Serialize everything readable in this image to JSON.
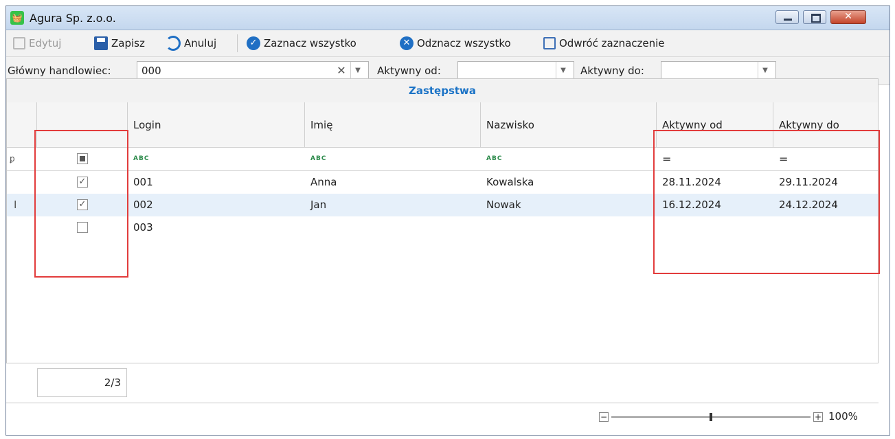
{
  "window": {
    "title": "Agura Sp. z.o.o.",
    "close_glyph": "✕"
  },
  "toolbar": {
    "edit_label": "Edytuj",
    "save_label": "Zapisz",
    "cancel_label": "Anuluj",
    "select_all_label": "Zaznacz wszystko",
    "deselect_all_label": "Odznacz wszystko",
    "invert_label": "Odwróć zaznaczenie",
    "check_glyph": "✓",
    "x_glyph": "✕"
  },
  "filters": {
    "main_dealer_label": "Główny handlowiec:",
    "main_dealer_value": "000",
    "active_from_label": "Aktywny od:",
    "active_from_value": "",
    "active_to_label": "Aktywny do:",
    "active_to_value": "",
    "clear_glyph": "✕",
    "dropdown_glyph": "▼"
  },
  "grid": {
    "group_title": "Zastępstwa",
    "columns": {
      "login": "Login",
      "imie": "Imię",
      "nazwisko": "Nazwisko",
      "aktywny_od": "Aktywny od",
      "aktywny_do": "Aktywny do"
    },
    "filter_row": {
      "pin_glyph": "ꝑ",
      "text_glyph": "ABC",
      "equals_glyph": "="
    },
    "rows": [
      {
        "checked": "✓",
        "login": "001",
        "imie": "Anna",
        "nazwisko": "Kowalska",
        "aktywny_od": "28.11.2024",
        "aktywny_do": "29.11.2024"
      },
      {
        "checked": "✓",
        "login": "002",
        "imie": "Jan",
        "nazwisko": "Nowak",
        "aktywny_od": "16.12.2024",
        "aktywny_do": "24.12.2024",
        "cursor": "I"
      },
      {
        "checked": "",
        "login": "003",
        "imie": "",
        "nazwisko": "",
        "aktywny_od": "",
        "aktywny_do": ""
      }
    ],
    "record_counter": "2/3"
  },
  "zoom": {
    "minus": "−",
    "plus": "+",
    "level": "100%",
    "position": 0.5
  },
  "colors": {
    "accent": "#1b73c6",
    "highlight_box": "#e23c3c",
    "selected_row": "#e6f0fa"
  },
  "icons": [
    "app-basket-icon",
    "edit-icon",
    "save-icon",
    "undo-icon",
    "check-circle-icon",
    "x-circle-icon",
    "invert-selection-icon",
    "clear-icon",
    "chevron-down-icon",
    "pin-icon"
  ]
}
